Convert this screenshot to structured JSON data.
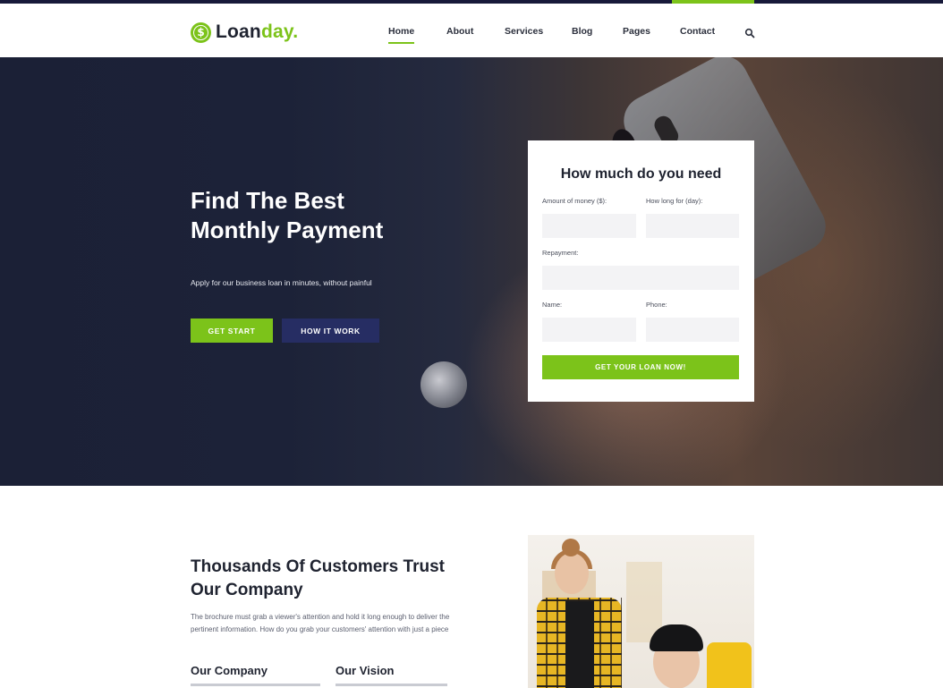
{
  "brand": {
    "name_part1": "Loan",
    "name_part2": "day.",
    "icon": "dollar-coin-icon",
    "accent_color": "#7cc31a",
    "navy_color": "#262d63"
  },
  "nav": {
    "items": [
      {
        "label": "Home",
        "active": true
      },
      {
        "label": "About",
        "active": false
      },
      {
        "label": "Services",
        "active": false
      },
      {
        "label": "Blog",
        "active": false
      },
      {
        "label": "Pages",
        "active": false
      },
      {
        "label": "Contact",
        "active": false
      }
    ],
    "search_icon": "search-icon"
  },
  "hero": {
    "title_line1": "Find The Best",
    "title_line2": "Monthly Payment",
    "subtitle": "Apply for our business loan in minutes, without painful",
    "primary_button": "GET START",
    "secondary_button": "HOW IT WORK"
  },
  "loan_form": {
    "title": "How much do you need",
    "amount_label": "Amount of money ($):",
    "amount_value": "",
    "duration_label": "How long for (day):",
    "duration_value": "",
    "repayment_label": "Repayment:",
    "repayment_value": "",
    "name_label": "Name:",
    "name_value": "",
    "phone_label": "Phone:",
    "phone_value": "",
    "submit_label": "GET YOUR LOAN NOW!"
  },
  "about": {
    "title_line1": "Thousands Of Customers Trust",
    "title_line2": "Our Company",
    "text_line1": "The brochure must grab a viewer's attention and hold it long enough to deliver the",
    "text_line2": "pertinent information. How do you grab your customers' attention with just a piece",
    "col1_title": "Our Company",
    "col2_title": "Our Vision"
  }
}
